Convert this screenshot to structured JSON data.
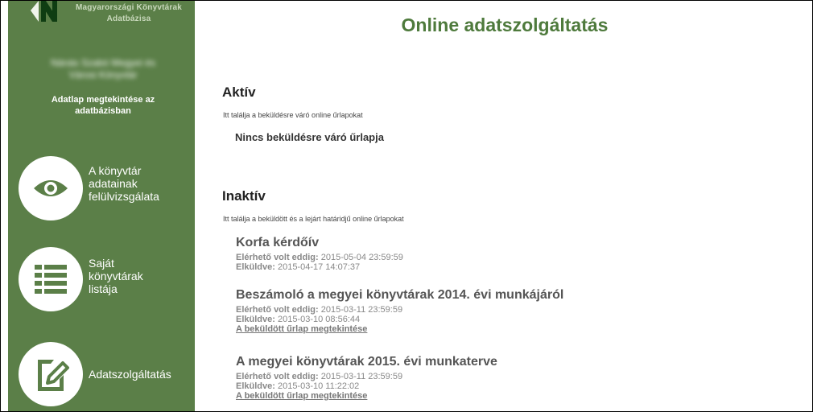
{
  "sidebar": {
    "logo_text_line1": "Magyarországi Könyvtárak",
    "logo_text_line2": "Adatbázisa",
    "library_name_line1": "Nánás Szabó Megyei és",
    "library_name_line2": "Városi Könyvtár",
    "adatlap_link_line1": "Adatlap megtekintése az",
    "adatlap_link_line2": "adatbázisban",
    "nav": [
      {
        "line1": "A könyvtár",
        "line2": "adatainak",
        "line3": "felülvizsgálata",
        "icon": "eye-icon"
      },
      {
        "line1": "Saját",
        "line2": "könyvtárak",
        "line3": "listája",
        "icon": "list-icon"
      },
      {
        "line1": "Adatszolgáltatás",
        "icon": "edit-icon"
      }
    ],
    "colors": {
      "background": "#5b7f48"
    }
  },
  "main": {
    "title": "Online adatszolgáltatás",
    "active": {
      "heading": "Aktív",
      "subtitle": "Itt találja a beküldésre váró online űrlapokat",
      "empty": "Nincs beküldésre váró űrlapja"
    },
    "inactive": {
      "heading": "Inaktív",
      "subtitle": "Itt találja a beküldött és a lejárt határidjű online űrlapokat",
      "forms": [
        {
          "title": "Korfa kérdőív",
          "deadline_label": "Elérhető volt eddig:",
          "deadline": " 2015-05-04 23:59:59",
          "sent_label": "Elküldve:",
          "sent": " 2015-04-17 14:07:37"
        },
        {
          "title": "Beszámoló a megyei könyvtárak 2014. évi munkájáról",
          "deadline_label": "Elérhető volt eddig:",
          "deadline": " 2015-03-11 23:59:59",
          "sent_label": "Elküldve:",
          "sent": " 2015-03-10 08:56:44",
          "link": "A beküldött űrlap megtekintése"
        },
        {
          "title": "A megyei könyvtárak 2015. évi munkaterve",
          "deadline_label": "Elérhető volt eddig:",
          "deadline": " 2015-03-11 23:59:59",
          "sent_label": "Elküldve:",
          "sent": " 2015-03-10 11:22:02",
          "link": "A beküldött űrlap megtekintése"
        }
      ]
    },
    "colors": {
      "title": "#4e7a3c"
    }
  }
}
